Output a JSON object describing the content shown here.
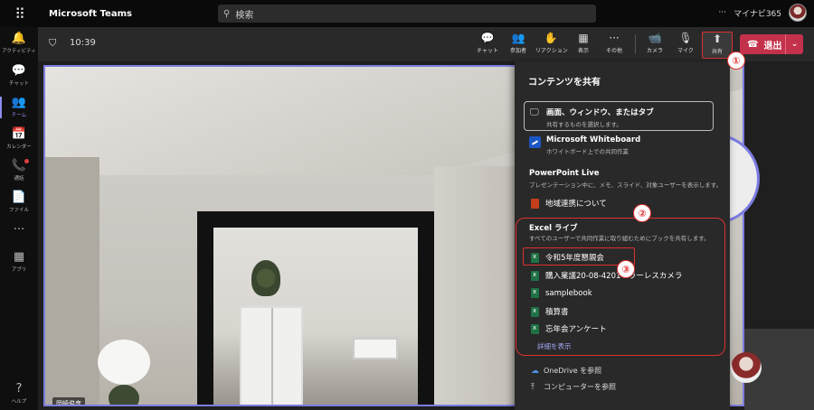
{
  "titlebar": {
    "app_name": "Microsoft Teams",
    "search_placeholder": "検索",
    "more": "···",
    "user_name": "マイナビ365"
  },
  "rail": [
    {
      "icon": "🔔",
      "label": "アクティビティ"
    },
    {
      "icon": "💬",
      "label": "チャット"
    },
    {
      "icon": "👥",
      "label": "チーム"
    },
    {
      "icon": "📅",
      "label": "カレンダー"
    },
    {
      "icon": "📞",
      "label": "通話"
    },
    {
      "icon": "📄",
      "label": "ファイル"
    },
    {
      "icon": "···",
      "label": ""
    },
    {
      "icon": "▦",
      "label": "アプリ"
    },
    {
      "icon": "?",
      "label": "ヘルプ"
    }
  ],
  "meeting": {
    "time": "10:39",
    "buttons": [
      {
        "icon": "💬",
        "label": "チャット"
      },
      {
        "icon": "👥",
        "label": "参加者"
      },
      {
        "icon": "✋",
        "label": "リアクション"
      },
      {
        "icon": "▦",
        "label": "表示"
      },
      {
        "icon": "···",
        "label": "その他"
      },
      {
        "icon": "📹",
        "label": "カメラ"
      },
      {
        "icon": "🎙",
        "label": "マイク"
      },
      {
        "icon": "⬆",
        "label": "共有"
      }
    ],
    "leave_label": "退出"
  },
  "video": {
    "participant_name": "岡崎俊彦"
  },
  "markers": [
    "①",
    "②",
    "③"
  ],
  "share_panel": {
    "title": "コンテンツを共有",
    "screen": {
      "title": "画面、ウィンドウ、またはタブ",
      "subtitle": "共有するものを選択します。"
    },
    "whiteboard": {
      "title": "Microsoft Whiteboard",
      "subtitle": "ホワイトボード上での共同作業"
    },
    "ppt_section": {
      "title": "PowerPoint Live",
      "subtitle": "プレゼンテーション中に、メモ、スライド、対象ユーザーを表示します。"
    },
    "ppt_files": [
      "地域連携について"
    ],
    "excel_section": {
      "title": "Excel ライブ",
      "subtitle": "すべてのユーザーで共同作業に取り組むためにブックを共有します。"
    },
    "excel_files": [
      "令和5年度懇親会",
      "購入稟議20-08-4201ミラーレスカメラ",
      "samplebook",
      "積算書",
      "忘年会アンケート"
    ],
    "more_link": "詳細を表示",
    "onedrive": "OneDrive を参照",
    "computer": "コンピューターを参照"
  }
}
